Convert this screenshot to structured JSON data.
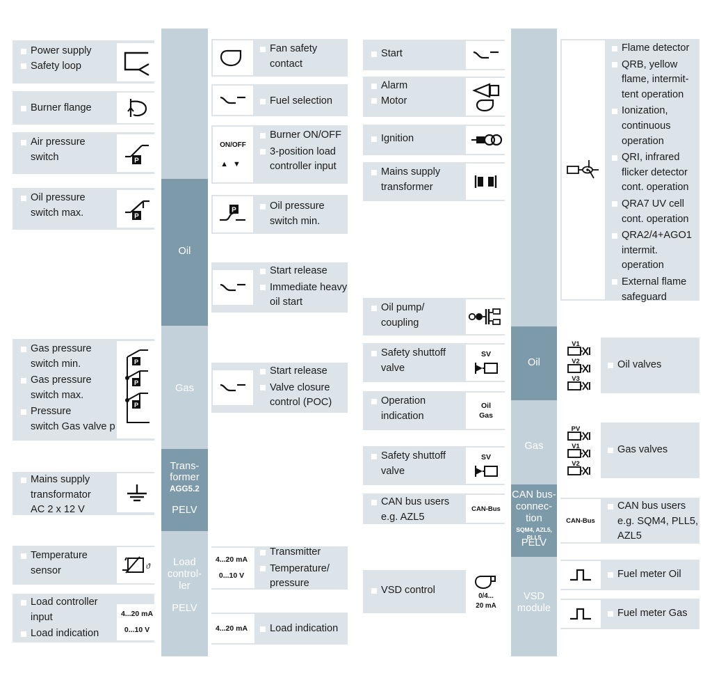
{
  "colors": {
    "row_bg": "#dde4e9",
    "bar_light": "#c3d1da",
    "bar_dark": "#7d9aab",
    "symbol_bg": "#ffffff",
    "text": "#1b1b1b",
    "bar_text": "#ffffff"
  },
  "bars": {
    "left": [
      {
        "label": "",
        "sub": "",
        "pelv": "",
        "tone": "light"
      },
      {
        "label": "Oil",
        "sub": "",
        "pelv": "",
        "tone": "dark"
      },
      {
        "label": "Gas",
        "sub": "",
        "pelv": "",
        "tone": "light"
      },
      {
        "label": "Trans-\nformer",
        "sub": "AGG5.2",
        "pelv": "PELV",
        "tone": "dark"
      },
      {
        "label": "Load\ncontrol-\nler",
        "sub": "",
        "pelv": "PELV",
        "tone": "light"
      }
    ],
    "right": [
      {
        "label": "",
        "sub": "",
        "pelv": "",
        "tone": "light"
      },
      {
        "label": "Oil",
        "sub": "",
        "pelv": "",
        "tone": "dark"
      },
      {
        "label": "Gas",
        "sub": "",
        "pelv": "",
        "tone": "light"
      },
      {
        "label": "CAN bus-\nconnec-\ntion",
        "sub": "SQM4, AZL5, PLL5",
        "pelv": "PELV",
        "tone": "dark"
      },
      {
        "label": "VSD\nmodule",
        "sub": "",
        "pelv": "",
        "tone": "light"
      }
    ],
    "left_text": {
      "oil": "Oil",
      "gas": "Gas",
      "transformer_l1": "Trans-",
      "transformer_l2": "former",
      "transformer_sub": "AGG5.2",
      "transformer_pelv": "PELV",
      "load_l1": "Load",
      "load_l2": "control-",
      "load_l3": "ler",
      "load_pelv": "PELV"
    },
    "right_text": {
      "oil": "Oil",
      "gas": "Gas",
      "can_l1": "CAN bus-",
      "can_l2": "connec-",
      "can_l3": "tion",
      "can_sub": "SQM4, AZL5, PLL5",
      "can_pelv": "PELV",
      "vsd_l1": "VSD",
      "vsd_l2": "module"
    }
  },
  "col1": [
    {
      "labels": [
        "Power supply",
        "Safety loop"
      ],
      "symbol": "safety-loop-contact-symbol"
    },
    {
      "labels": [
        "Burner flange"
      ],
      "symbol": "burner-flange-symbol"
    },
    {
      "labels": [
        "Air pressure",
        "switch"
      ],
      "symbol": "air-pressure-switch-symbol"
    },
    {
      "labels": [
        "Oil pressure",
        "switch max."
      ],
      "symbol": "oil-pressure-switch-max-symbol"
    },
    {
      "labels": [
        "Gas pressure",
        "switch min.",
        "Gas pressure",
        "switch max.",
        "Pressure",
        "switch Gas valve p"
      ],
      "symbol": "gas-pressure-switch-group-symbol"
    },
    {
      "labels": [
        "Mains supply",
        "transformator",
        "AC 2 x 12 V"
      ],
      "symbol": "earth-ground-symbol"
    },
    {
      "labels": [
        "Temperature",
        "sensor"
      ],
      "symbol": "temperature-sensor-symbol"
    },
    {
      "labels": [
        "Load controller",
        "input",
        "Load indication"
      ],
      "symbol": "current-voltage-range-symbol",
      "symbol_text": [
        "4...20 mA",
        "0...10 V"
      ]
    }
  ],
  "col2": [
    {
      "labels": [
        "Fan safety",
        "contact"
      ],
      "symbol": "fan-symbol"
    },
    {
      "labels": [
        "Fuel selection"
      ],
      "symbol": "changeover-contact-symbol"
    },
    {
      "labels": [
        "Burner ON/OFF",
        "3-position load",
        "controller input"
      ],
      "symbol": "on-off-updown-symbol",
      "symbol_text": [
        "ON/OFF"
      ]
    },
    {
      "labels": [
        "Oil pressure",
        "switch min."
      ],
      "symbol": "oil-pressure-switch-min-symbol"
    },
    {
      "labels": [
        "Start release",
        "Immediate heavy",
        "oil start"
      ],
      "symbol": "changeover-contact-symbol"
    },
    {
      "labels": [
        "Start release",
        "Valve closure",
        "control (POC)"
      ],
      "symbol": "changeover-contact-symbol"
    },
    {
      "labels": [
        "Transmitter",
        "Temperature/",
        "pressure"
      ],
      "symbol": "signal-range-symbol",
      "symbol_text": [
        "4...20 mA",
        "0...10 V"
      ]
    },
    {
      "labels": [
        "Load indication"
      ],
      "symbol": "signal-range-symbol",
      "symbol_text": [
        "4...20 mA"
      ]
    }
  ],
  "col3": [
    {
      "labels": [
        "Start"
      ],
      "symbol": "changeover-contact-symbol"
    },
    {
      "labels": [
        "Alarm",
        "Motor"
      ],
      "symbol": "alarm-horn-motor-symbol"
    },
    {
      "labels": [
        "Ignition"
      ],
      "symbol": "ignition-transformer-symbol"
    },
    {
      "labels": [
        "Mains supply",
        "transformer"
      ],
      "symbol": "transformer-symbol"
    },
    {
      "labels": [
        "Oil pump/",
        "coupling"
      ],
      "symbol": "oil-pump-coupling-symbol"
    },
    {
      "labels": [
        "Safety shuttoff",
        "valve"
      ],
      "symbol": "safety-shutoff-valve-symbol",
      "symbol_text": [
        "SV"
      ]
    },
    {
      "labels": [
        "Operation",
        "indication"
      ],
      "symbol": "operation-indication-symbol",
      "symbol_text": [
        "Oil",
        "Gas"
      ]
    },
    {
      "labels": [
        "Safety shuttoff",
        "valve"
      ],
      "symbol": "safety-shutoff-valve-symbol",
      "symbol_text": [
        "SV"
      ]
    },
    {
      "labels": [
        "CAN bus users",
        "e.g. AZL5"
      ],
      "symbol": "can-bus-symbol",
      "symbol_text": [
        "CAN-Bus"
      ]
    },
    {
      "labels": [
        "VSD control"
      ],
      "symbol": "vsd-control-symbol",
      "symbol_text": [
        "0/4...",
        "20 mA"
      ]
    }
  ],
  "col4": [
    {
      "labels": [
        "Flame detector",
        "QRB, yellow",
        "flame, intermit-",
        "tent operation",
        "Ionization,",
        "continuous",
        "operation",
        "QRI, infrared",
        "flicker detector",
        "cont. operation",
        "QRA7 UV cell",
        "cont. operation",
        "QRA2/4+AGO1",
        "intermit.",
        "operation",
        "External flame",
        "safeguard"
      ],
      "symbol": "flame-detector-symbol"
    },
    {
      "labels": [
        "Oil valves"
      ],
      "symbol": "oil-valves-symbol",
      "symbol_text": [
        "V1",
        "V2",
        "V3"
      ]
    },
    {
      "labels": [
        "Gas valves"
      ],
      "symbol": "gas-valves-symbol",
      "symbol_text": [
        "PV",
        "V1",
        "V2"
      ]
    },
    {
      "labels": [
        "CAN bus users",
        "e.g. SQM4, PLL5,",
        "AZL5"
      ],
      "symbol": "can-bus-symbol",
      "symbol_text": [
        "CAN-Bus"
      ]
    },
    {
      "labels": [
        "Fuel meter Oil"
      ],
      "symbol": "pulse-symbol"
    },
    {
      "labels": [
        "Fuel meter Gas"
      ],
      "symbol": "pulse-symbol"
    }
  ]
}
